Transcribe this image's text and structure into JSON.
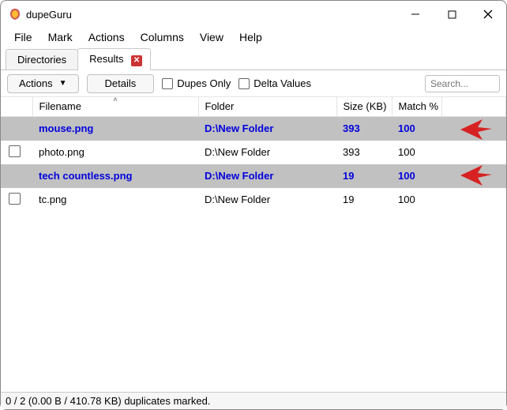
{
  "window": {
    "title": "dupeGuru"
  },
  "menubar": {
    "items": [
      "File",
      "Mark",
      "Actions",
      "Columns",
      "View",
      "Help"
    ]
  },
  "tabs": {
    "directories": "Directories",
    "results": "Results"
  },
  "toolbar": {
    "actions": "Actions",
    "details": "Details",
    "dupes_only": "Dupes Only",
    "delta_values": "Delta Values",
    "search_placeholder": "Search..."
  },
  "columns": {
    "filename": "Filename",
    "folder": "Folder",
    "size": "Size (KB)",
    "match": "Match %"
  },
  "rows": [
    {
      "type": "head",
      "filename": "mouse.png",
      "folder": "D:\\New Folder",
      "size": "393",
      "match": "100"
    },
    {
      "type": "dupe",
      "filename": "photo.png",
      "folder": "D:\\New Folder",
      "size": "393",
      "match": "100"
    },
    {
      "type": "head",
      "filename": "tech countless.png",
      "folder": "D:\\New Folder",
      "size": "19",
      "match": "100"
    },
    {
      "type": "dupe",
      "filename": "tc.png",
      "folder": "D:\\New Folder",
      "size": "19",
      "match": "100"
    }
  ],
  "status": {
    "text": "0 / 2 (0.00 B / 410.78 KB) duplicates marked."
  }
}
